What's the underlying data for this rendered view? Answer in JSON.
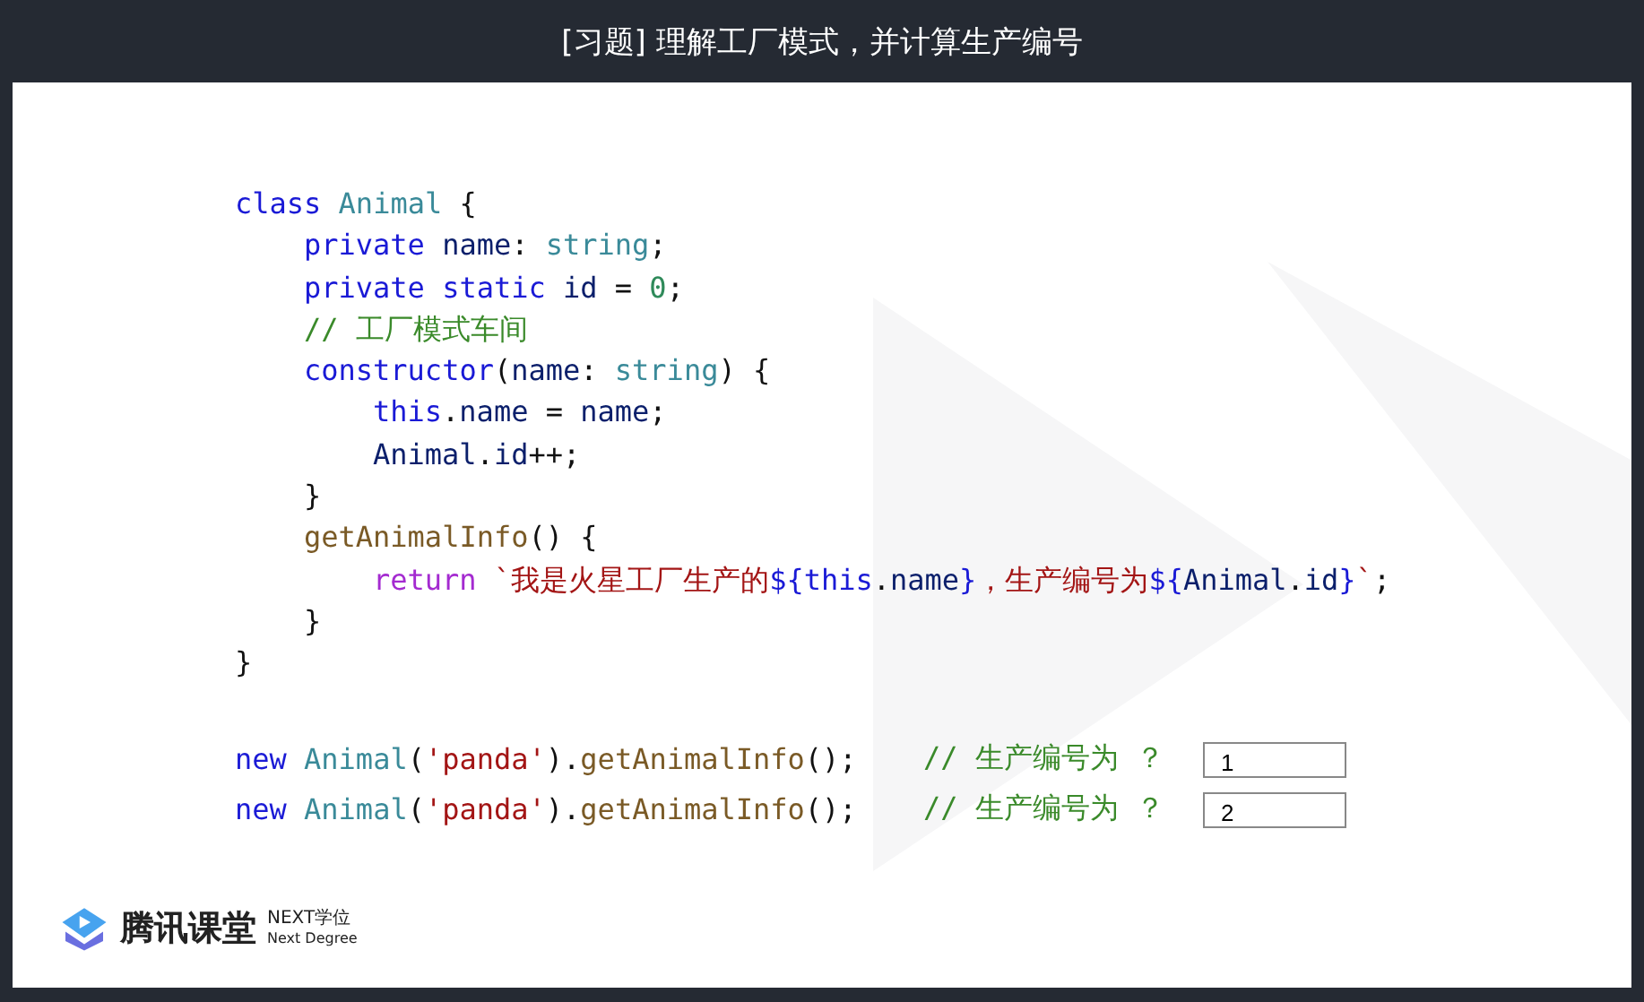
{
  "window": {
    "title": "[习题] 理解工厂模式，并计算生产编号"
  },
  "code": [
    {
      "tokens": [
        {
          "text": "class ",
          "kind": "kw"
        },
        {
          "text": "Animal",
          "kind": "type"
        },
        {
          "text": " {",
          "kind": "punct"
        }
      ],
      "children": [
        {
          "tokens": [
            {
              "text": "private ",
              "kind": "kw"
            },
            {
              "text": "name",
              "kind": "ident"
            },
            {
              "text": ": ",
              "kind": "punct"
            },
            {
              "text": "string",
              "kind": "type"
            },
            {
              "text": ";",
              "kind": "punct"
            }
          ]
        },
        {
          "tokens": [
            {
              "text": "private static ",
              "kind": "kw"
            },
            {
              "text": "id",
              "kind": "ident"
            },
            {
              "text": " = ",
              "kind": "punct"
            },
            {
              "text": "0",
              "kind": "num"
            },
            {
              "text": ";",
              "kind": "punct"
            }
          ]
        },
        {
          "tokens": [
            {
              "text": "// 工厂模式车间",
              "kind": "comment"
            }
          ]
        },
        {
          "tokens": [
            {
              "text": "constructor",
              "kind": "kw"
            },
            {
              "text": "(",
              "kind": "punct"
            },
            {
              "text": "name",
              "kind": "ident"
            },
            {
              "text": ": ",
              "kind": "punct"
            },
            {
              "text": "string",
              "kind": "type"
            },
            {
              "text": ") {",
              "kind": "punct"
            }
          ],
          "children": [
            {
              "tokens": [
                {
                  "text": "this",
                  "kind": "kw"
                },
                {
                  "text": ".",
                  "kind": "punct"
                },
                {
                  "text": "name",
                  "kind": "ident"
                },
                {
                  "text": " = ",
                  "kind": "punct"
                },
                {
                  "text": "name",
                  "kind": "ident"
                },
                {
                  "text": ";",
                  "kind": "punct"
                }
              ]
            },
            {
              "tokens": [
                {
                  "text": "Animal",
                  "kind": "ident"
                },
                {
                  "text": ".",
                  "kind": "punct"
                },
                {
                  "text": "id",
                  "kind": "ident"
                },
                {
                  "text": "++;",
                  "kind": "punct"
                }
              ]
            }
          ]
        },
        {
          "tokens": [
            {
              "text": "}",
              "kind": "punct"
            }
          ]
        },
        {
          "tokens": [
            {
              "text": "getAnimalInfo",
              "kind": "fn"
            },
            {
              "text": "() {",
              "kind": "punct"
            }
          ],
          "children": [
            {
              "tokens": [
                {
                  "text": "return ",
                  "kind": "ctrl"
                },
                {
                  "text": "`我是火星工厂生产的",
                  "kind": "str"
                },
                {
                  "text": "${this",
                  "kind": "kw"
                },
                {
                  "text": ".",
                  "kind": "punct"
                },
                {
                  "text": "name",
                  "kind": "ident"
                },
                {
                  "text": "}",
                  "kind": "kw"
                },
                {
                  "text": "，生产编号为",
                  "kind": "str"
                },
                {
                  "text": "${",
                  "kind": "kw"
                },
                {
                  "text": "Animal",
                  "kind": "ident"
                },
                {
                  "text": ".",
                  "kind": "punct"
                },
                {
                  "text": "id",
                  "kind": "ident"
                },
                {
                  "text": "}",
                  "kind": "kw"
                },
                {
                  "text": "`",
                  "kind": "str"
                },
                {
                  "text": ";",
                  "kind": "punct"
                }
              ]
            }
          ]
        },
        {
          "tokens": [
            {
              "text": "}",
              "kind": "punct"
            }
          ]
        }
      ]
    },
    {
      "tokens": [
        {
          "text": "}",
          "kind": "punct"
        }
      ]
    }
  ],
  "questions": [
    {
      "tokens": [
        {
          "text": "new ",
          "kind": "kw"
        },
        {
          "text": "Animal",
          "kind": "type"
        },
        {
          "text": "(",
          "kind": "punct"
        },
        {
          "text": "'panda'",
          "kind": "str"
        },
        {
          "text": ").",
          "kind": "punct"
        },
        {
          "text": "getAnimalInfo",
          "kind": "fn"
        },
        {
          "text": "();",
          "kind": "punct"
        }
      ],
      "comment": "// 生产编号为 ？",
      "answer": "1"
    },
    {
      "tokens": [
        {
          "text": "new ",
          "kind": "kw"
        },
        {
          "text": "Animal",
          "kind": "type"
        },
        {
          "text": "(",
          "kind": "punct"
        },
        {
          "text": "'panda'",
          "kind": "str"
        },
        {
          "text": ").",
          "kind": "punct"
        },
        {
          "text": "getAnimalInfo",
          "kind": "fn"
        },
        {
          "text": "();",
          "kind": "punct"
        }
      ],
      "comment": "// 生产编号为 ？",
      "answer": "2"
    }
  ],
  "logo": {
    "name": "腾讯课堂",
    "tag_top": "NEXT学位",
    "tag_bottom": "Next Degree"
  }
}
